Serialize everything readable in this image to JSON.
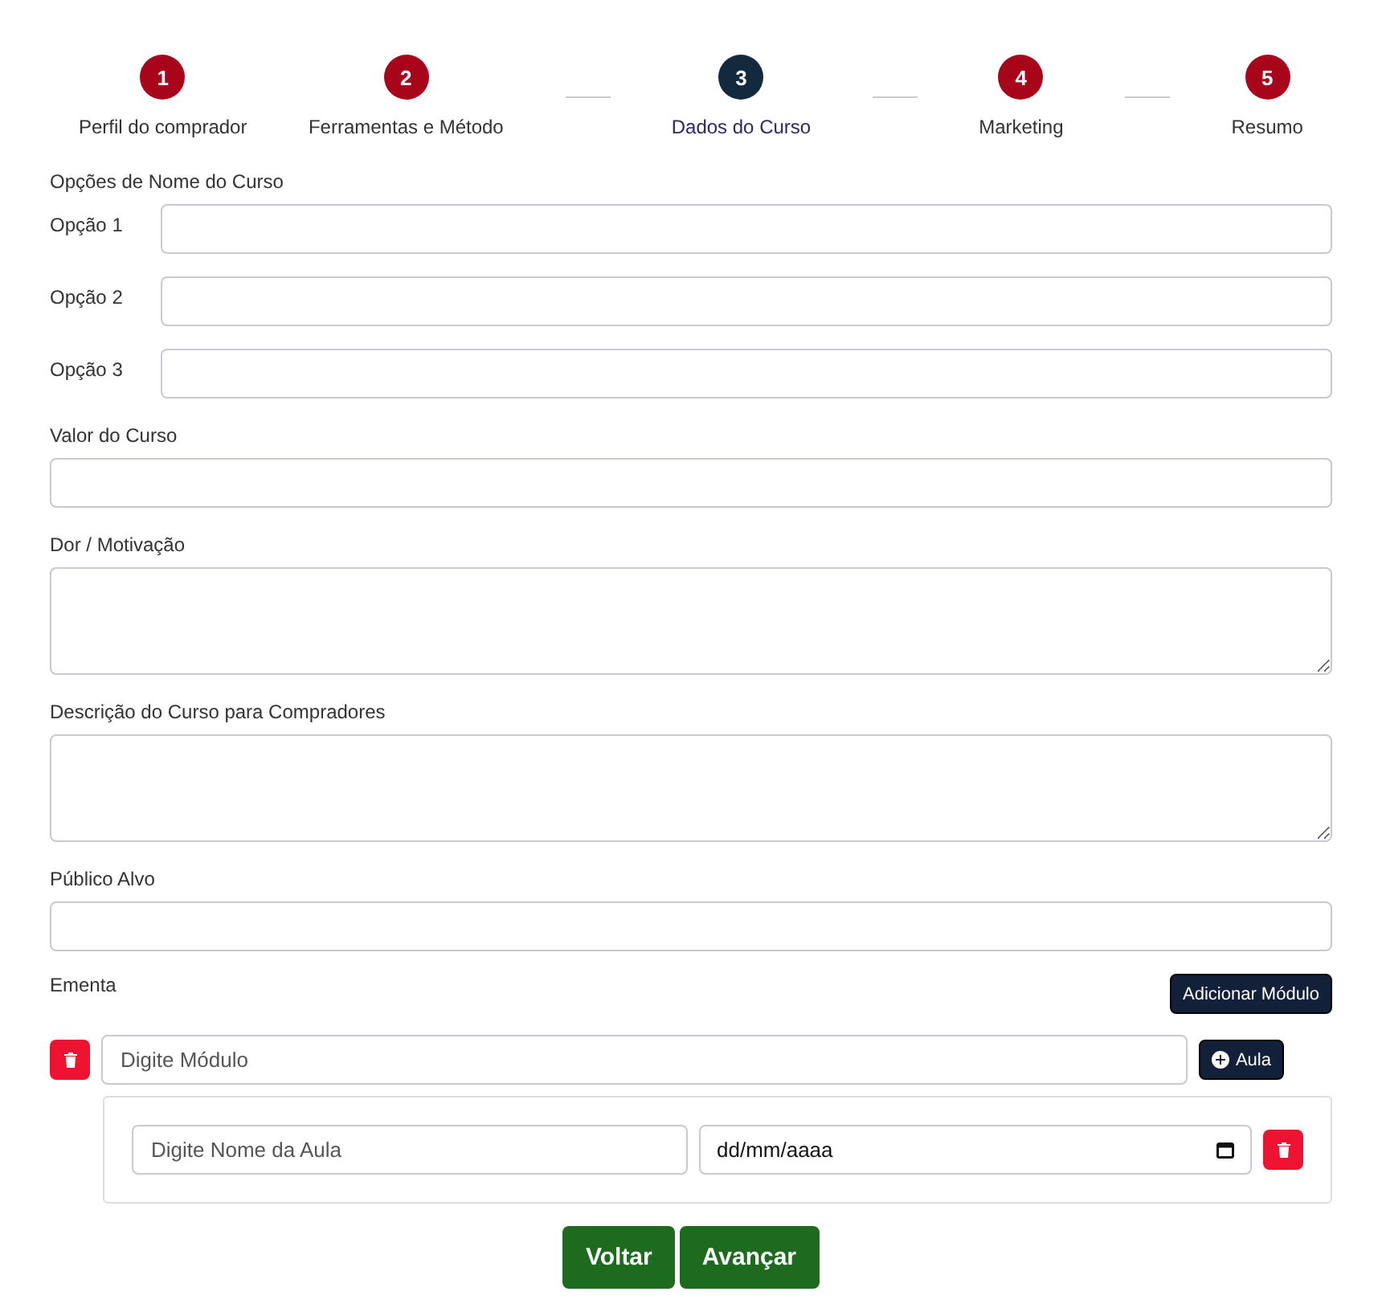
{
  "steps": [
    {
      "number": "1",
      "label": "Perfil do comprador",
      "selected": false
    },
    {
      "number": "2",
      "label": "Ferramentas e Método",
      "selected": false
    },
    {
      "number": "3",
      "label": "Dados do Curso",
      "selected": true
    },
    {
      "number": "4",
      "label": "Marketing",
      "selected": false
    },
    {
      "number": "5",
      "label": "Resumo",
      "selected": false
    }
  ],
  "name_options": {
    "title": "Opções de Nome do Curso",
    "options": [
      {
        "label": "Opção 1"
      },
      {
        "label": "Opção 2"
      },
      {
        "label": "Opção 3"
      }
    ]
  },
  "fields": [
    {
      "kind": "input",
      "label": "Valor do Curso"
    },
    {
      "kind": "textarea",
      "label": "Dor / Motivação"
    },
    {
      "kind": "textarea",
      "label": "Descrição do Curso para Compradores"
    },
    {
      "kind": "input",
      "label": "Público Alvo"
    }
  ],
  "syllabus": {
    "label": "Ementa",
    "add_module_button": "Adicionar Módulo",
    "modules": [
      {
        "placeholder": "Digite Módulo",
        "add_lesson_button": "Aula",
        "lessons": [
          {
            "placeholder": "Digite Nome da Aula",
            "date": "dd/mm/aaaa"
          }
        ]
      }
    ]
  },
  "buttons": [
    "Voltar",
    "Avançar"
  ]
}
